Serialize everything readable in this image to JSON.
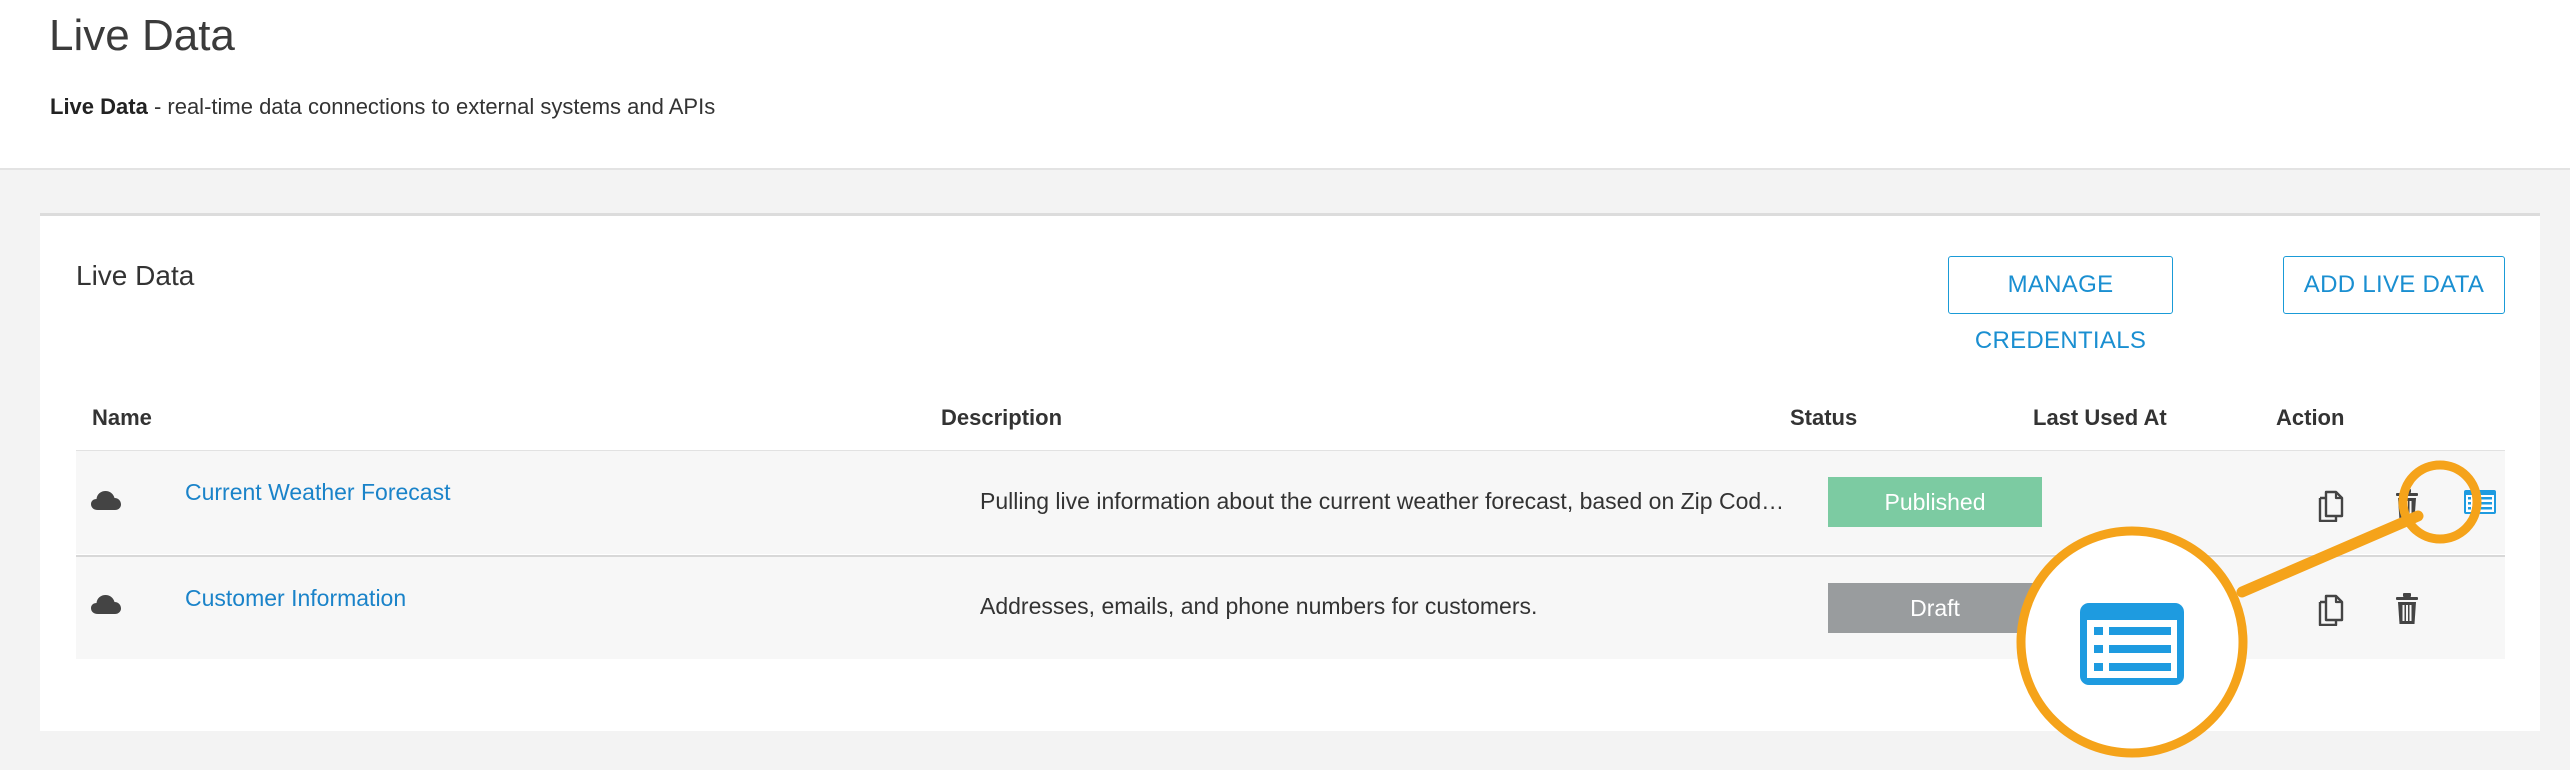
{
  "header": {
    "title": "Live Data",
    "subtitle_bold": "Live Data",
    "subtitle_rest": " - real-time data connections to external systems and APIs"
  },
  "card": {
    "title": "Live Data",
    "manage_credentials_label": "MANAGE CREDENTIALS",
    "add_live_data_label": "ADD LIVE DATA"
  },
  "table": {
    "columns": [
      "Name",
      "Description",
      "Status",
      "Last Used At",
      "Action"
    ],
    "rows": [
      {
        "name": "Current Weather Forecast",
        "description": "Pulling live information about the current weather forecast, based on Zip Cod…",
        "status": "Published",
        "last_used_at": ""
      },
      {
        "name": "Customer Information",
        "description": "Addresses, emails, and phone numbers for customers.",
        "status": "Draft",
        "last_used_at": ""
      }
    ]
  },
  "icons": {
    "row_type": "cloud-icon",
    "duplicate": "copy-icon",
    "delete": "trash-icon",
    "details": "list-details-icon"
  },
  "colors": {
    "link": "#1a83c9",
    "button_border": "#1a9bd7",
    "published": "#7ccba2",
    "draft": "#999c9e",
    "highlight": "#f5a31a",
    "details_icon": "#1e9be0"
  }
}
